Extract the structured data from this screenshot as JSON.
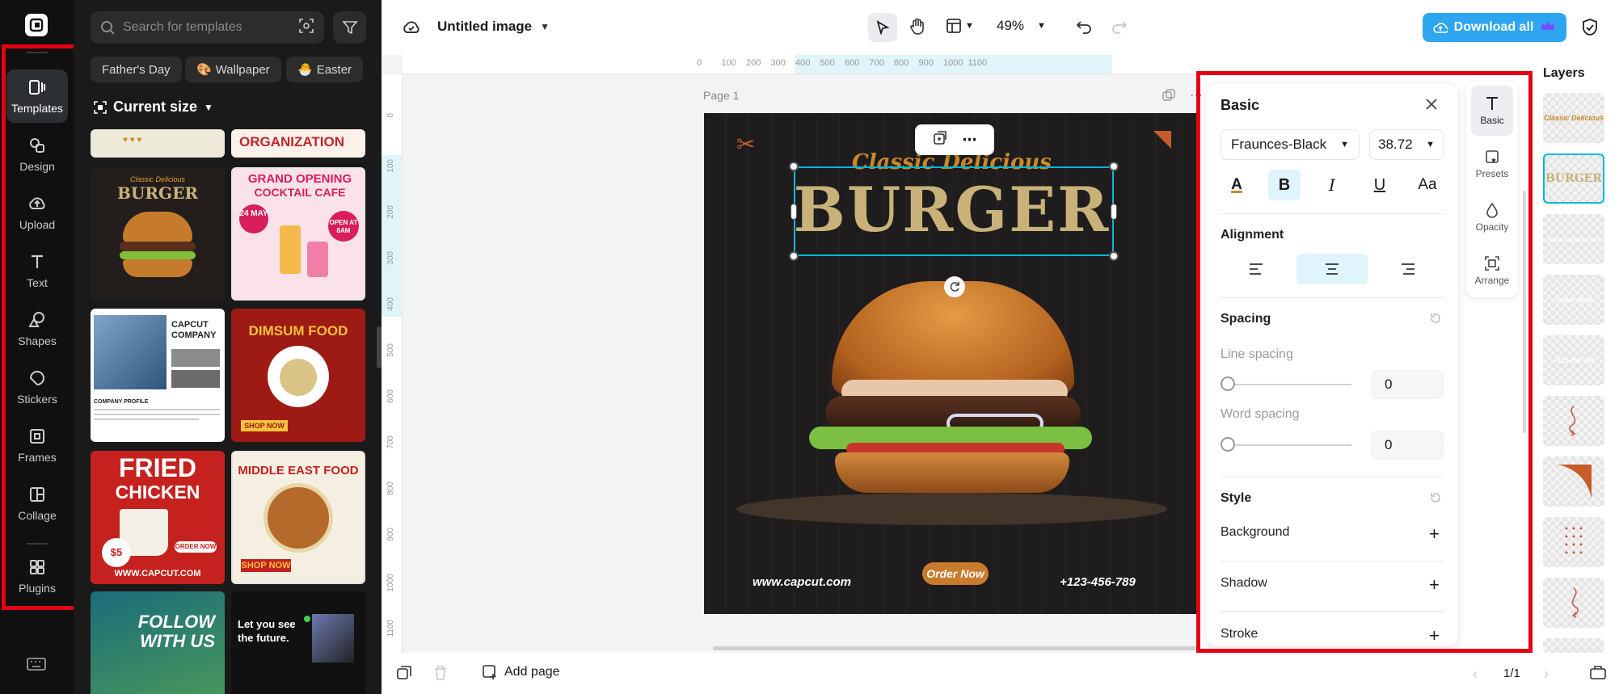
{
  "rail": {
    "items": [
      {
        "label": "Templates",
        "icon": "templates-icon"
      },
      {
        "label": "Design",
        "icon": "design-icon"
      },
      {
        "label": "Upload",
        "icon": "upload-icon"
      },
      {
        "label": "Text",
        "icon": "text-icon"
      },
      {
        "label": "Shapes",
        "icon": "shapes-icon"
      },
      {
        "label": "Stickers",
        "icon": "stickers-icon"
      },
      {
        "label": "Frames",
        "icon": "frames-icon"
      },
      {
        "label": "Collage",
        "icon": "collage-icon"
      },
      {
        "label": "Plugins",
        "icon": "plugins-icon"
      }
    ]
  },
  "templates": {
    "search_placeholder": "Search for templates",
    "chips": [
      "Father's Day",
      "Wallpaper",
      "Easter"
    ],
    "current_size": "Current size",
    "cards": {
      "org": "ORGANIZATION",
      "burger_sub": "Classic Delicious",
      "burger": "BURGER",
      "grand1": "GRAND OPENING",
      "grand2": "COCKTAIL CAFE",
      "grand_date": "24 MAY",
      "grand_open": "OPEN AT 8AM",
      "capcut1": "CAPCUT",
      "capcut2": "COMPANY",
      "company_profile": "COMPANY PROFILE",
      "dimsum": "DIMSUM FOOD",
      "dimsum_shop": "SHOP NOW",
      "fried1": "FRIED",
      "fried2": "CHICKEN",
      "fried_price": "$5",
      "fried_order": "ORDER NOW",
      "fried_url": "WWW.CAPCUT.COM",
      "middle": "MIDDLE EAST FOOD",
      "middle_shop": "SHOP NOW",
      "follow": "FOLLOW WITH US",
      "future": "Let you see the future."
    }
  },
  "topbar": {
    "doc_title": "Untitled image",
    "zoom": "49%",
    "download": "Download all"
  },
  "ruler": {
    "ticks": [
      "0",
      "100",
      "200",
      "300",
      "400",
      "500",
      "600",
      "700",
      "800",
      "900",
      "1000",
      "1100"
    ],
    "vticks": [
      "0",
      "100",
      "200",
      "300",
      "400",
      "500",
      "600",
      "700",
      "800",
      "900",
      "1000",
      "1100"
    ]
  },
  "canvas": {
    "page_label": "Page 1",
    "design": {
      "subtitle": "Classic Delicious",
      "title": "BURGER",
      "url": "www.capcut.com",
      "order": "Order Now",
      "phone": "+123-456-789"
    }
  },
  "props": {
    "title": "Basic",
    "font": "Fraunces-Black",
    "size": "38.72",
    "alignment_label": "Alignment",
    "spacing_label": "Spacing",
    "line_spacing_label": "Line spacing",
    "line_spacing_value": "0",
    "word_spacing_label": "Word spacing",
    "word_spacing_value": "0",
    "style_label": "Style",
    "background_label": "Background",
    "shadow_label": "Shadow",
    "stroke_label": "Stroke",
    "case_glyph": "Aa"
  },
  "sidetabs": [
    "Basic",
    "Presets",
    "Opacity",
    "Arrange"
  ],
  "layers": {
    "title": "Layers",
    "item1": "Classic Delicious",
    "item2": "BURGER",
    "item3": "www.capcut.com",
    "item4": "Order Now",
    "item5": "+123-456-789"
  },
  "bottombar": {
    "add_page": "Add page",
    "page_count": "1/1"
  },
  "colors": {
    "accent": "#1fa8e8",
    "highlight": "#e60012",
    "selection": "#00b8d9",
    "burger_gold": "#c9b27a"
  }
}
